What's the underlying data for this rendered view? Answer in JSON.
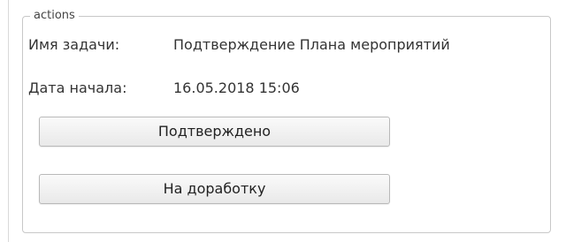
{
  "panel": {
    "legend": "actions",
    "task_name_label": "Имя задачи:",
    "task_name_value": "Подтверждение Плана мероприятий",
    "start_date_label": "Дата начала:",
    "start_date_value": "16.05.2018 15:06"
  },
  "buttons": {
    "confirm_label": "Подтверждено",
    "rework_label": "На доработку"
  }
}
